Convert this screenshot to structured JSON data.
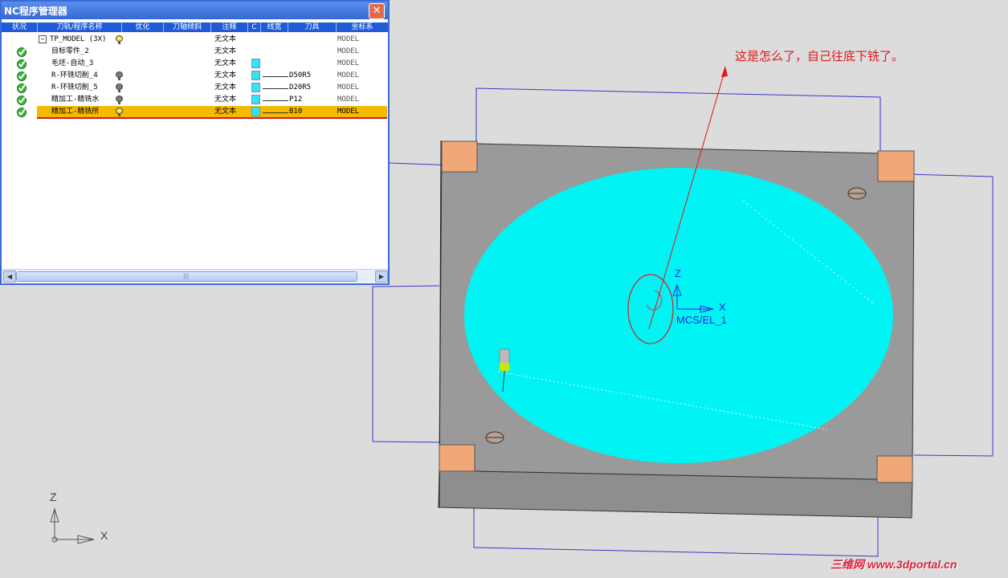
{
  "window": {
    "title": "NC程序管理器",
    "close_glyph": "✕"
  },
  "columns": [
    "状况",
    "刀轨/程序名称",
    "优化",
    "刀轴倾斜",
    "注释",
    "C",
    "线宽",
    "刀具",
    "坐标系"
  ],
  "rows": [
    {
      "name": "TP_MODEL (3X)",
      "status": "",
      "bulb": "yellow",
      "comment": "无文本",
      "color": false,
      "tool": "",
      "coord": "MODEL"
    },
    {
      "name": "目标零件_2",
      "status": "ok",
      "bulb": "",
      "comment": "无文本",
      "color": false,
      "tool": "",
      "coord": "MODEL"
    },
    {
      "name": "毛坯-自动_3",
      "status": "ok",
      "bulb": "",
      "comment": "无文本",
      "color": true,
      "tool": "",
      "coord": "MODEL"
    },
    {
      "name": "R-环铣切削_4",
      "status": "ok",
      "bulb": "gray",
      "comment": "无文本",
      "color": true,
      "tool": "D50R5",
      "coord": "MODEL"
    },
    {
      "name": "R-环铣切削_5",
      "status": "ok",
      "bulb": "gray",
      "comment": "无文本",
      "color": true,
      "tool": "D20R5",
      "coord": "MODEL"
    },
    {
      "name": "精加工-精铣水",
      "status": "ok",
      "bulb": "gray",
      "comment": "无文本",
      "color": true,
      "tool": "P12",
      "coord": "MODEL"
    },
    {
      "name": "精加工-精铣所",
      "status": "ok",
      "bulb": "yellow",
      "comment": "无文本",
      "color": true,
      "tool": "B10",
      "coord": "MODEL"
    }
  ],
  "selected_row": 6,
  "annotation": "这是怎么了，自己往底下铣了。",
  "mcs": {
    "label": "MCS/EL_1",
    "z": "Z",
    "x": "X"
  },
  "axes": {
    "z": "Z",
    "x": "X"
  },
  "watermark": "三维网 www.3dportal.cn",
  "colors": {
    "part_gray": "#9a9a9a",
    "toolpath_cyan": "#00f4f4",
    "clamp": "#f0a878",
    "frame": "#3838c8",
    "annotation_red": "#e01818"
  }
}
